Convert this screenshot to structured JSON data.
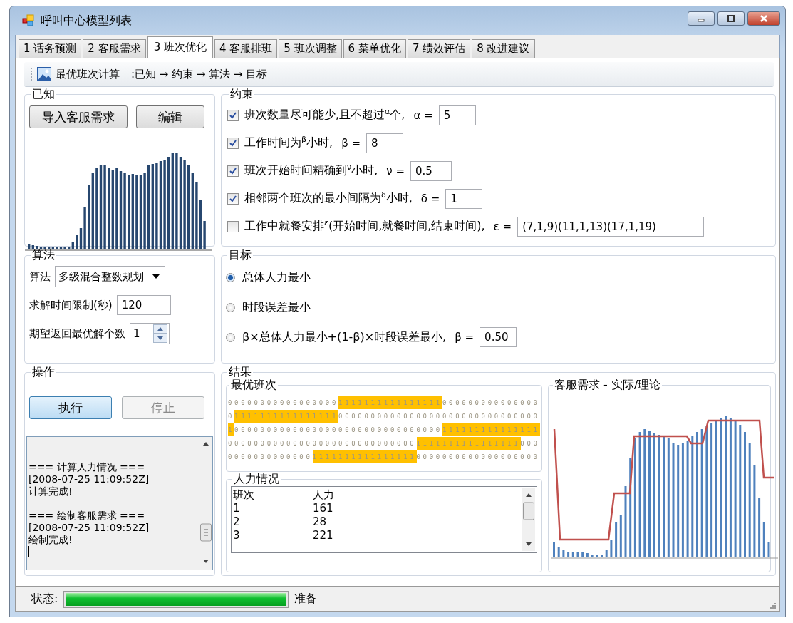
{
  "window": {
    "title": "呼叫中心模型列表"
  },
  "tabs": [
    {
      "label": "1 话务预测",
      "selected": false
    },
    {
      "label": "2 客服需求",
      "selected": false
    },
    {
      "label": "3 班次优化",
      "selected": true
    },
    {
      "label": "4 客服排班",
      "selected": false
    },
    {
      "label": "5 班次调整",
      "selected": false
    },
    {
      "label": "6 菜单优化",
      "selected": false
    },
    {
      "label": "7 绩效评估",
      "selected": false
    },
    {
      "label": "8 改进建议",
      "selected": false
    }
  ],
  "toolbar": {
    "title": "最优班次计算",
    "path": ":已知 → 约束 → 算法 → 目标"
  },
  "known": {
    "title": "已知",
    "buttons": [
      "导入客服需求",
      "编辑"
    ]
  },
  "constraints": {
    "title": "约束",
    "items": [
      {
        "label": "班次数量尽可能少,且不超过$^{α}$个,",
        "symbol": "α =",
        "value": "5",
        "checked": true
      },
      {
        "label": "工作时间为$^{β}$小时,",
        "symbol": "β =",
        "value": "8",
        "checked": true
      },
      {
        "label": "班次开始时间精确到$^{ν}$小时,",
        "symbol": "ν =",
        "value": "0.5",
        "checked": true
      },
      {
        "label": "相邻两个班次的最小间隔为$^{δ}$小时,",
        "symbol": "δ =",
        "value": "1",
        "checked": true
      },
      {
        "label": "工作中就餐安排$^{ε}$(开始时间,就餐时间,结束时间),",
        "symbol": "ε =",
        "value": "(7,1,9)(11,1,13)(17,1,19)",
        "checked": false
      }
    ]
  },
  "algorithm": {
    "title": "算法",
    "method_label": "算法",
    "method": "多级混合整数规划",
    "time_limit_label": "求解时间限制(秒)",
    "time_limit": "120",
    "solutions_label": "期望返回最优解个数",
    "solutions": "1"
  },
  "objective": {
    "title": "目标",
    "options": [
      {
        "label": "总体人力最小",
        "selected": true
      },
      {
        "label": "时段误差最小",
        "selected": false
      },
      {
        "label": "β×总体人力最小+(1-β)×时段误差最小,",
        "symbol": "β =",
        "value": "0.50",
        "selected": false
      }
    ]
  },
  "operation": {
    "title": "操作",
    "buttons": [
      {
        "label": "执行",
        "disabled": false
      },
      {
        "label": "停止",
        "disabled": true
      }
    ],
    "log": [
      {
        "header": "=== 计算人力情况 ===",
        "time": "[2008-07-25 11:09:52Z]",
        "message": "计算完成!"
      },
      {
        "header": "=== 绘制客服需求 ===",
        "time": "[2008-07-25 11:09:52Z]",
        "message": "绘制完成!"
      }
    ]
  },
  "result": {
    "title": "结果",
    "shifts": {
      "title": "最优班次",
      "rows": [
        "000000000000000001111111111111111000000000000000",
        "011111111111111110000000000000000000000000000000",
        "100000000000000000000000000000000111111111111111",
        "000000000000000000000000000001111111111111111000",
        "000000000000011111111111111110000000000000000000"
      ]
    },
    "staffing": {
      "title": "人力情况",
      "columns": [
        "班次",
        "人力"
      ],
      "rows": [
        [
          "1",
          "161"
        ],
        [
          "2",
          "28"
        ],
        [
          "3",
          "221"
        ]
      ]
    },
    "demand": {
      "title": "客服需求 - 实际/理论"
    }
  },
  "status_bar": {
    "label": "状态:",
    "level": 1,
    "text": "准备"
  }
}
